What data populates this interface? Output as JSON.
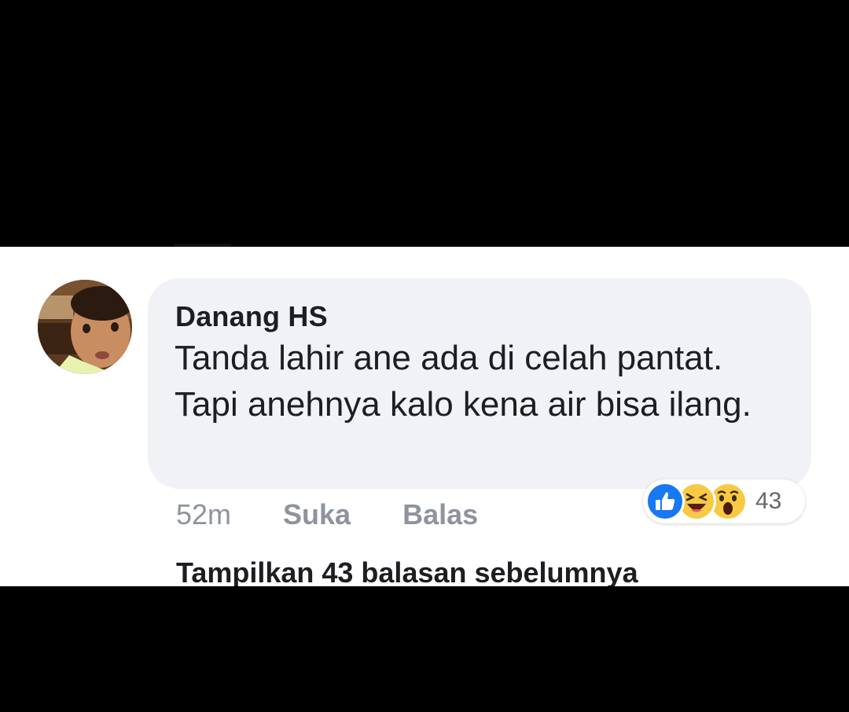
{
  "comment": {
    "author": "Danang HS",
    "text": "Tanda lahir ane ada di celah pantat. Tapi anehnya kalo kena air bisa ilang.",
    "time": "52m",
    "like_label": "Suka",
    "reply_label": "Balas",
    "reactions": {
      "icons": [
        "like-icon",
        "haha-icon",
        "wow-icon"
      ],
      "count": "43"
    }
  },
  "replies": {
    "show_previous_label": "Tampilkan 43 balasan sebelumnya"
  },
  "colors": {
    "bubble": "#f0f2f5",
    "meta_gray": "#8d949e",
    "like_blue": "#1877f2",
    "emoji_yellow": "#f7c944"
  }
}
